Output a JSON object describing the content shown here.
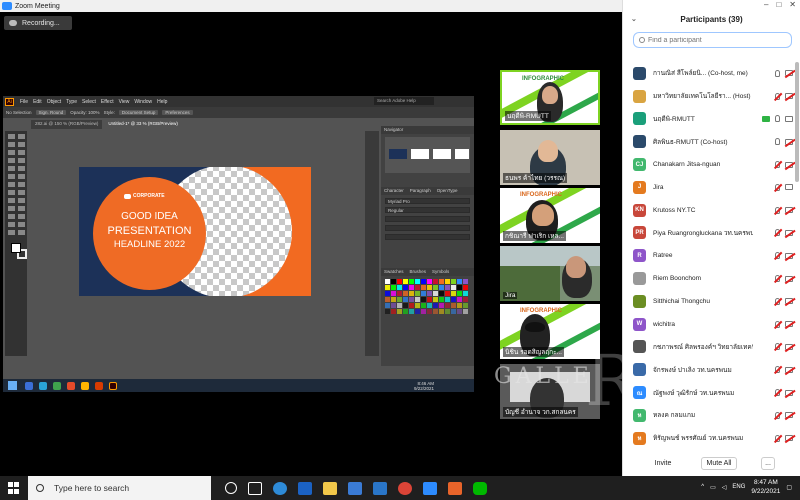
{
  "zoom": {
    "window_title": "Zoom Meeting",
    "recording_label": "Recording..."
  },
  "illustrator": {
    "logo": "Ai",
    "menu": [
      "File",
      "Edit",
      "Object",
      "Type",
      "Select",
      "Effect",
      "View",
      "Window",
      "Help"
    ],
    "search_placeholder": "Search Adobe Help",
    "control_bar": [
      "No Selection",
      "Sign. Round",
      "Opacity: 100%",
      "Style:",
      "Document Setup",
      "Preferences"
    ],
    "doc_tabs": [
      "282.ai @ 150 % (RGB/Preview)",
      "Untitled-1* @ 33 % (RGB/Preview)"
    ],
    "panels": [
      "Navigator",
      "Character",
      "Paragraph",
      "OpenType",
      "Swatches",
      "Brushes",
      "Symbols"
    ],
    "font_field": "Myriad Pro",
    "font_style": "Regular",
    "artboard": {
      "logo_text": "CORPORATE",
      "line1": "GOOD IDEA",
      "line2": "PRESENTATION",
      "line3": "HEADLINE 2022"
    },
    "status_zoom": "33%",
    "status_tool": "Selection",
    "clock_time": "8:46 AM",
    "clock_date": "9/22/2021"
  },
  "videos": [
    {
      "label": "นฤดีพิ-RMUTT"
    },
    {
      "label": "ธนพร ค้าไทย (วรรณ)"
    },
    {
      "label": "กชิณารี ฟาเริก เหล..."
    },
    {
      "label": "Jira"
    },
    {
      "label": "นิชิน รอดสิญลฤกะ..."
    },
    {
      "label": "บัญชี อำนาจ วก.สกลนคร"
    }
  ],
  "watermark": "GALLE",
  "participants": {
    "title": "Participants (39)",
    "search_placeholder": "Find a participant",
    "list": [
      {
        "initials": "",
        "color": "#2b4a6b",
        "name": "กานณิส่ สีโพล์ยนิ... (Co-host, me)",
        "mic": "on",
        "cam": "off"
      },
      {
        "initials": "",
        "color": "#d9a441",
        "name": "มหาวิทยาลัยเทคโนโลยีรา... (Host)",
        "mic": "muted",
        "cam": "off"
      },
      {
        "initials": "",
        "color": "#1a9f7a",
        "name": "นฤดีพิ-RMUTT",
        "mic": "on",
        "cam": "on"
      },
      {
        "initials": "",
        "color": "#2b4a6b",
        "name": "ศิลพินธ-RMUTT (Co-host)",
        "mic": "on",
        "cam": "off"
      },
      {
        "initials": "CJ",
        "color": "#42b86e",
        "name": "Chanakarn Jitsa-nguan",
        "mic": "muted",
        "cam": "off"
      },
      {
        "initials": "J",
        "color": "#e47a1f",
        "name": "Jira",
        "mic": "muted",
        "cam": "on"
      },
      {
        "initials": "KN",
        "color": "#c8473a",
        "name": "Krutoss NY.TC",
        "mic": "muted",
        "cam": "off"
      },
      {
        "initials": "PR",
        "color": "#c8473a",
        "name": "Piya Ruangrongluckana วท.นครพนม",
        "mic": "muted",
        "cam": "off"
      },
      {
        "initials": "R",
        "color": "#8e55c9",
        "name": "Ratree",
        "mic": "muted",
        "cam": "off"
      },
      {
        "initials": "",
        "color": "#999999",
        "name": "Riem Boonchom",
        "mic": "muted",
        "cam": "off"
      },
      {
        "initials": "",
        "color": "#6b8e23",
        "name": "Sitthichai Thongchu",
        "mic": "muted",
        "cam": "off"
      },
      {
        "initials": "W",
        "color": "#8e55c9",
        "name": "wichitra",
        "mic": "muted",
        "cam": "off"
      },
      {
        "initials": "",
        "color": "#555555",
        "name": "กชภาพรณ์ ศิลพรองค์ฯ วิทยาลัยเทคนิค...",
        "mic": "muted",
        "cam": "off"
      },
      {
        "initials": "",
        "color": "#3a6aa8",
        "name": "จักรพงษ์ ปาเลิง วท.นครพนม",
        "mic": "muted",
        "cam": "off"
      },
      {
        "initials": "ณ",
        "color": "#2d8cff",
        "name": "ณัฐพงษ์ วุฒิรักษ์ วท.นครพนม",
        "mic": "muted",
        "cam": "off"
      },
      {
        "initials": "ห",
        "color": "#42b86e",
        "name": "หลงค กลมแกม",
        "mic": "muted",
        "cam": "off"
      },
      {
        "initials": "ห",
        "color": "#e47a1f",
        "name": "หิรัญพนช์ พรรศัณย์ วท.นครพนม",
        "mic": "muted",
        "cam": "off"
      }
    ],
    "invite_label": "Invite",
    "mute_all_label": "Mute All",
    "more_label": "..."
  },
  "taskbar": {
    "search_placeholder": "Type here to search",
    "language": "ENG",
    "time": "8:47 AM",
    "date": "9/22/2021"
  }
}
